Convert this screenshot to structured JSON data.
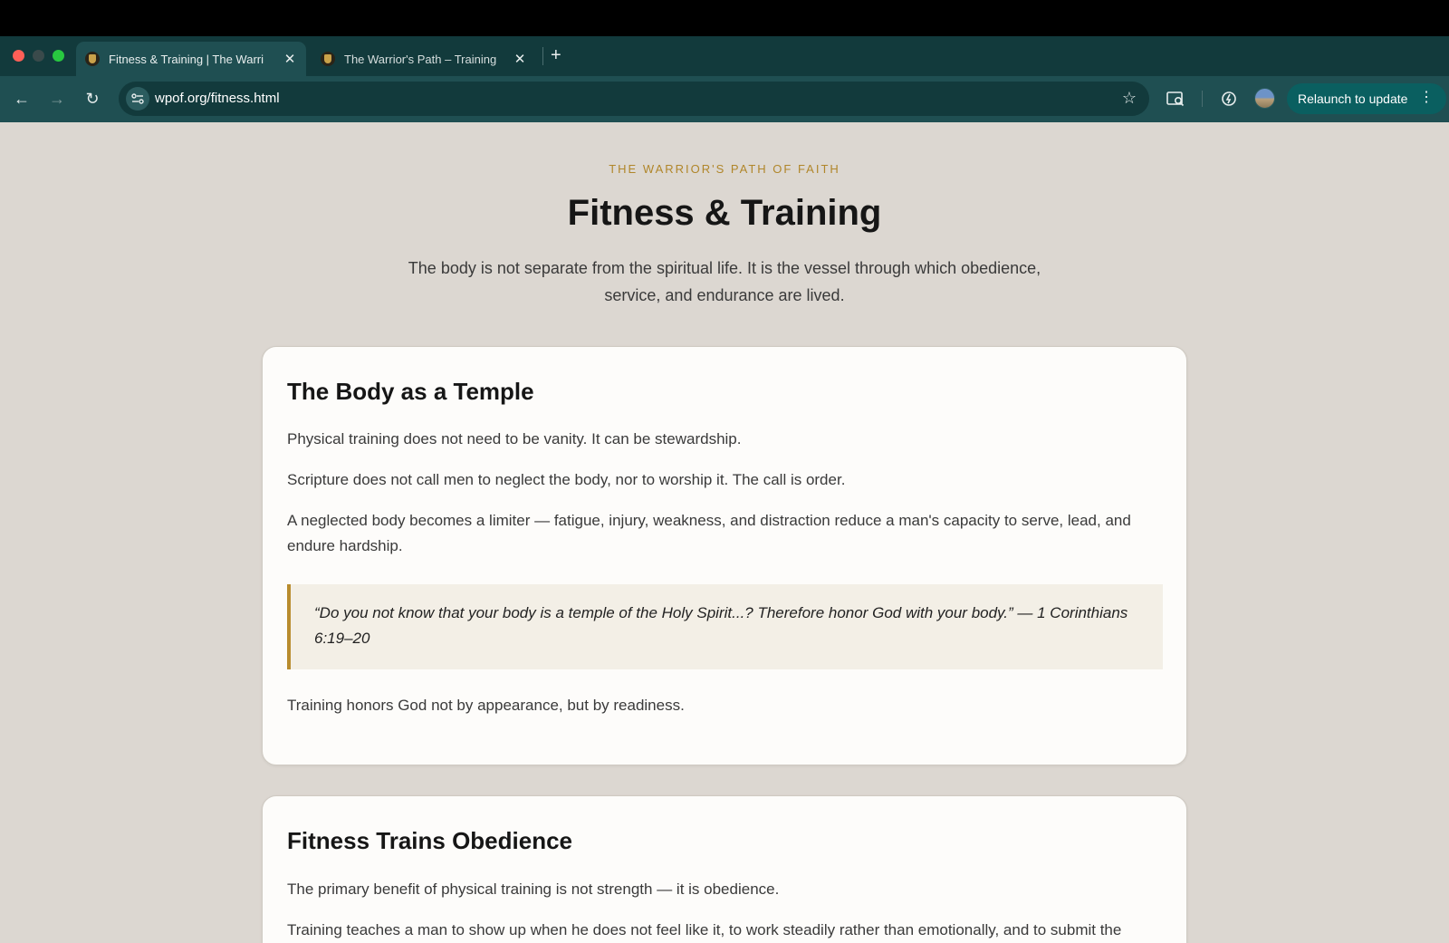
{
  "browser": {
    "tabs": [
      {
        "title": "Fitness & Training | The Warri",
        "close": "✕",
        "active": true
      },
      {
        "title": "The Warrior's Path – Training",
        "close": "✕",
        "active": false
      }
    ],
    "new_tab": "+",
    "url": "wpof.org/fitness.html",
    "relaunch_label": "Relaunch to update",
    "menu": "⋮",
    "icons": {
      "back": "←",
      "forward": "→",
      "reload": "↻",
      "star": "☆"
    }
  },
  "page": {
    "eyebrow": "THE WARRIOR'S PATH OF FAITH",
    "title": "Fitness & Training",
    "intro": "The body is not separate from the spiritual life. It is the vessel through which obedience, service, and endurance are lived."
  },
  "sections": [
    {
      "heading": "The Body as a Temple",
      "paragraphs": [
        "Physical training does not need to be vanity. It can be stewardship.",
        "Scripture does not call men to neglect the body, nor to worship it. The call is order.",
        "A neglected body becomes a limiter — fatigue, injury, weakness, and distraction reduce a man's capacity to serve, lead, and endure hardship."
      ],
      "quote": "“Do you not know that your body is a temple of the Holy Spirit...? Therefore honor God with your body.” — 1 Corinthians 6:19–20",
      "closing": "Training honors God not by appearance, but by readiness."
    },
    {
      "heading": "Fitness Trains Obedience",
      "paragraphs": [
        "The primary benefit of physical training is not strength — it is obedience.",
        "Training teaches a man to show up when he does not feel like it, to work steadily rather than emotionally, and to submit the"
      ]
    }
  ],
  "colors": {
    "tabstrip": "#123a3c",
    "toolbar": "#1f4f52",
    "page_bg": "#dcd7d1",
    "accent_gold": "#b0862a",
    "relaunch": "#0a5f60"
  }
}
